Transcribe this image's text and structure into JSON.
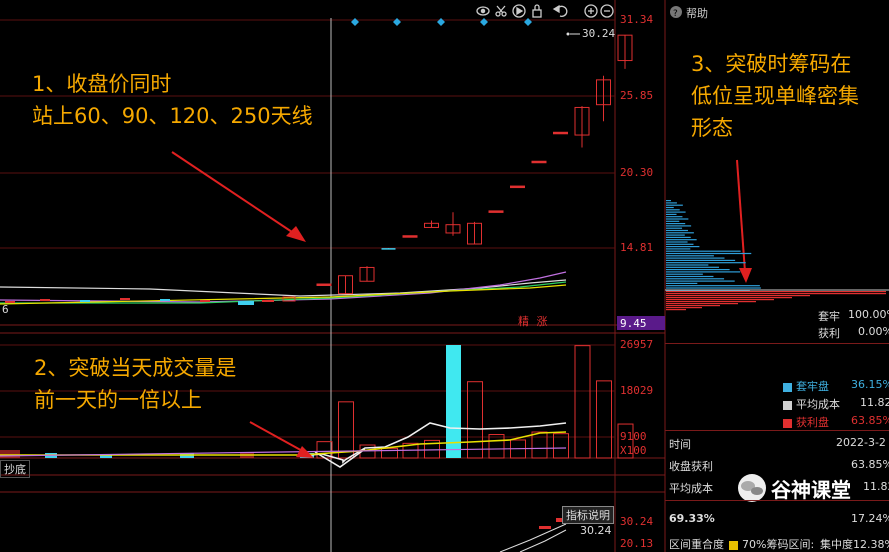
{
  "annotations": {
    "a1_line1": "1、收盘价同时",
    "a1_line2": "站上60、90、120、250天线",
    "a2_line1": "2、突破当天成交量是",
    "a2_line2": "前一天的一倍以上",
    "a3_line1": "3、突破时筹码在",
    "a3_line2": "低位呈现单峰密集",
    "a3_line3": "形态"
  },
  "price_axis": {
    "p1": "31.34",
    "p2": "25.85",
    "p3": "20.30",
    "p4": "14.81",
    "p5": "9.45"
  },
  "volume_axis": {
    "v1": "26957",
    "v2": "18029",
    "v3": "9100",
    "unit": "X100"
  },
  "sub_axis": {
    "s1": "30.24",
    "s2": "20.13"
  },
  "price_high_label": "30.24",
  "left_edge_label": "6",
  "jingzhang_label": "精 涨",
  "toolbar_icons": [
    "eye-icon",
    "scissors-icon",
    "play-icon",
    "lock-icon",
    "undo-icon",
    "zoom-in-icon",
    "zoom-out-icon"
  ],
  "bottom": {
    "chaodi_tab": "抄底",
    "indicator_btn": "指标说明"
  },
  "right_panel": {
    "help_label": "帮助",
    "taolao_label": "套牢",
    "taolao_value": "100.00%",
    "huoli_label": "获利",
    "huoli_value": "0.00%",
    "legend": [
      {
        "label": "套牢盘",
        "value": "36.15%",
        "color": "#3fb0e0"
      },
      {
        "label": "平均成本",
        "value": "11.82",
        "color": "#d0d0d0"
      },
      {
        "label": "获利盘",
        "value": "63.85%",
        "color": "#e03030"
      }
    ],
    "rows": [
      {
        "label": "时间",
        "value": "2022-3-2"
      },
      {
        "label": "收盘获利",
        "value": "63.85%"
      },
      {
        "label": "平均成本",
        "value": "11.82"
      }
    ],
    "pct_left": "69.33%",
    "pct_right": "17.24%",
    "concentration_label": "区间重合度",
    "concentration_range": "70%筹码区间:",
    "concentration_value": "集中度12.38%"
  },
  "watermark_text": "谷神课堂",
  "chart_data": {
    "type": "candlestick",
    "y_ticks": [
      31.34,
      25.85,
      20.3,
      14.81,
      9.45
    ],
    "ylim": [
      9.45,
      31.34
    ],
    "volume_ticks": [
      26957,
      18029,
      9100
    ],
    "volume_ylim": [
      0,
      26957
    ],
    "candles": [
      {
        "open": 12.2,
        "high": 12.2,
        "low": 12.1,
        "close": 12.15
      },
      {
        "open": 11.5,
        "high": 12.8,
        "low": 11.5,
        "close": 12.8
      },
      {
        "open": 12.4,
        "high": 13.5,
        "low": 12.4,
        "close": 13.4
      },
      {
        "open": 14.7,
        "high": 14.8,
        "low": 14.7,
        "close": 14.8
      },
      {
        "open": 15.6,
        "high": 15.7,
        "low": 15.6,
        "close": 15.7
      },
      {
        "open": 16.3,
        "high": 16.8,
        "low": 16.3,
        "close": 16.6
      },
      {
        "open": 16.5,
        "high": 17.4,
        "low": 15.7,
        "close": 15.9
      },
      {
        "open": 15.1,
        "high": 16.7,
        "low": 15.1,
        "close": 16.6
      },
      {
        "open": 17.4,
        "high": 17.5,
        "low": 17.4,
        "close": 17.5
      },
      {
        "open": 19.2,
        "high": 19.3,
        "low": 19.2,
        "close": 19.3
      },
      {
        "open": 21.0,
        "high": 21.1,
        "low": 21.0,
        "close": 21.1
      },
      {
        "open": 23.1,
        "high": 23.2,
        "low": 23.1,
        "close": 23.2
      },
      {
        "open": 23.0,
        "high": 25.1,
        "low": 22.1,
        "close": 25.0
      },
      {
        "open": 25.2,
        "high": 27.3,
        "low": 24.0,
        "close": 27.0
      },
      {
        "open": 28.4,
        "high": 30.24,
        "low": 27.8,
        "close": 30.24
      }
    ],
    "volumes": [
      3900,
      13400,
      3100,
      2300,
      3500,
      4200,
      26957,
      18200,
      5600,
      4300,
      6200,
      5800,
      26800,
      18400,
      8100
    ],
    "ma_white": [
      6000,
      6500,
      6300,
      8000,
      12000,
      12500,
      12400,
      12300,
      12200,
      12100,
      12200,
      12400,
      12600
    ]
  }
}
